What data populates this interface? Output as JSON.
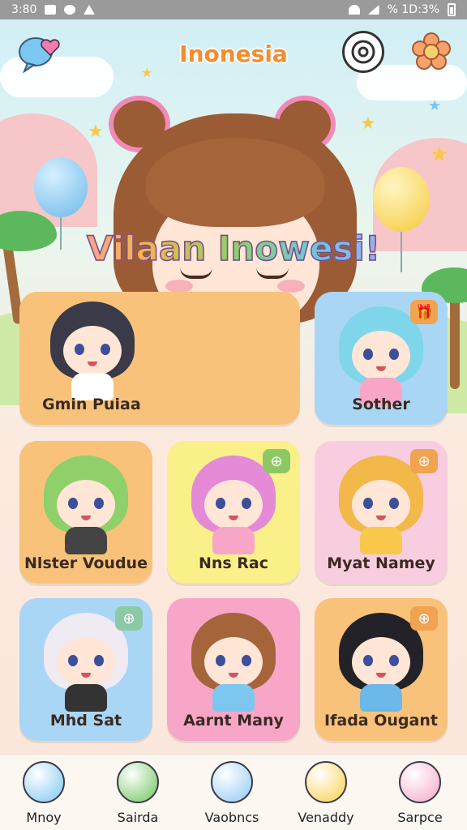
{
  "status_bar": {
    "time": "3:80",
    "battery_text": "% 1D:3%"
  },
  "header": {
    "title": "Inonesia"
  },
  "hero": {
    "welcome_text": "Vilaan Inowesi!"
  },
  "cards": [
    {
      "label": "Gmin Puiaa",
      "color": "#f8c27a"
    },
    {
      "label": "Sother",
      "color": "#a9d6f5",
      "badge": "gift-icon"
    },
    {
      "label": "Nlster Voudue",
      "color": "#f8c27a"
    },
    {
      "label": "Nns Rac",
      "color": "#f9f08a",
      "badge": "tag-icon"
    },
    {
      "label": "Myat Namey",
      "color": "#f9cde0",
      "badge": "tag-icon"
    },
    {
      "label": "Mhd Sat",
      "color": "#a9d6f5",
      "badge": "tag-icon"
    },
    {
      "label": "Aarnt Many",
      "color": "#f7a6c8"
    },
    {
      "label": "Ifada Ougant",
      "color": "#f8c27a",
      "badge": "tag-icon"
    }
  ],
  "bottom_nav": [
    {
      "label": "Mnoy",
      "icon": "cloud-icon"
    },
    {
      "label": "Sairda",
      "icon": "chat-heart-icon"
    },
    {
      "label": "Vaobncs",
      "icon": "chat-bubble-icon"
    },
    {
      "label": "Venaddy",
      "icon": "smiley-icon"
    },
    {
      "label": "Sarpce",
      "icon": "heart-face-icon"
    }
  ],
  "colors": {
    "title": "#f28d30",
    "accent_pink": "#f08bb8"
  }
}
